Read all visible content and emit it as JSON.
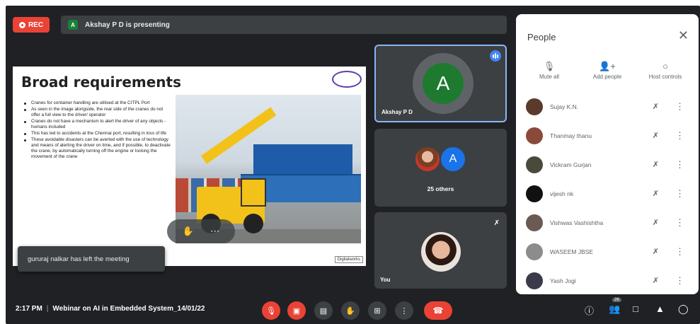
{
  "recording": {
    "label": "REC",
    "color": "#ea4335"
  },
  "presenter_bar": {
    "initial": "A",
    "text": "Akshay P D is presenting"
  },
  "slide": {
    "title": "Broad requirements",
    "logo_text": "",
    "bullets": [
      "Cranes for container handling are utilised at the CITPL Port",
      "As seen in the image alongside, the rear side of the cranes do not offer a full view to the driver/ operator",
      "Cranes do not have a mechanism to alert the driver of any objects - humans included",
      "This has led to accidents at the Chennai port, resulting in loss of life",
      "These avoidable disasters can be averted with the use of technology and means of alerting the driver on time, and if possible, to deactivate the crane, by automatically turning off the engine or locking the movement of the crane"
    ],
    "footer_brand": "Digitalworks"
  },
  "toast": {
    "text": "gururaj nalkar has left the meeting"
  },
  "tiles": {
    "presenter": {
      "initial": "A",
      "name": "Akshay P D"
    },
    "others": {
      "initial": "A",
      "label": "25 others"
    },
    "self": {
      "name": "You"
    }
  },
  "people_panel": {
    "title": "People",
    "actions": [
      {
        "label": "Mute all",
        "icon": "mic-off-icon"
      },
      {
        "label": "Add people",
        "icon": "add-person-icon"
      },
      {
        "label": "Host controls",
        "icon": "toggle-icon"
      }
    ],
    "participants": [
      {
        "name": "Sujay K.N."
      },
      {
        "name": "Thanmay thanu"
      },
      {
        "name": "Vickram Gurjan"
      },
      {
        "name": "vijesh nk"
      },
      {
        "name": "Vishwas Vashishtha"
      },
      {
        "name": "WASEEM JBSE"
      },
      {
        "name": "Yash Jogi"
      }
    ]
  },
  "bottom_bar": {
    "time": "2:17 PM",
    "separator": "|",
    "meeting_title": "Webinar on AI in Embedded System_14/01/22",
    "participant_count": "26"
  }
}
